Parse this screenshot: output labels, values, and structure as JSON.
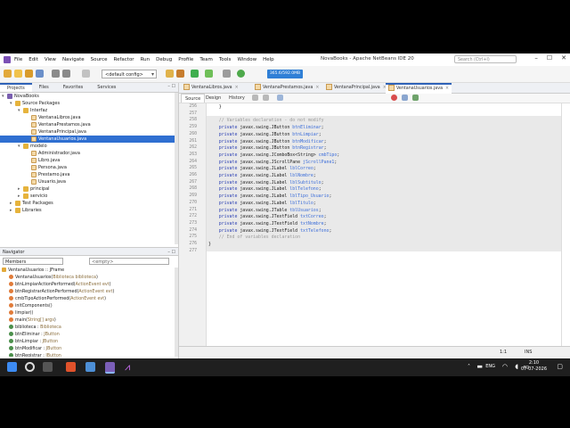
{
  "window": {
    "title": "NovaBooks - Apache NetBeans IDE 20",
    "search_placeholder": "Search (Ctrl+I)",
    "menu": [
      "File",
      "Edit",
      "View",
      "Navigate",
      "Source",
      "Refactor",
      "Run",
      "Debug",
      "Profile",
      "Team",
      "Tools",
      "Window",
      "Help"
    ],
    "controls": [
      "–",
      "☐",
      "✕"
    ]
  },
  "toolbar": {
    "config": "<default config>",
    "memory": "365.6/592.0MB"
  },
  "projects_panel": {
    "tabs": [
      "Projects",
      "Files",
      "Favorites",
      "Services"
    ],
    "active_tab": "Projects",
    "tree": [
      {
        "label": "NovaBooks",
        "level": 0,
        "icon": "project-icon",
        "arrow": "▾"
      },
      {
        "label": "Source Packages",
        "level": 1,
        "icon": "package-folder-icon",
        "arrow": "▾"
      },
      {
        "label": "Interfaz",
        "level": 2,
        "icon": "package-icon",
        "arrow": "▾"
      },
      {
        "label": "VentanaLibros.java",
        "level": 3,
        "icon": "java-file-icon",
        "arrow": ""
      },
      {
        "label": "VentanaPrestamos.java",
        "level": 3,
        "icon": "java-file-icon",
        "arrow": ""
      },
      {
        "label": "VentanaPrincipal.java",
        "level": 3,
        "icon": "java-file-icon",
        "arrow": ""
      },
      {
        "label": "VentanaUsuarios.java",
        "level": 3,
        "icon": "java-file-icon",
        "arrow": "",
        "selected": true
      },
      {
        "label": "modelo",
        "level": 2,
        "icon": "package-icon",
        "arrow": "▾"
      },
      {
        "label": "Administrador.java",
        "level": 3,
        "icon": "java-file-icon",
        "arrow": ""
      },
      {
        "label": "Libro.java",
        "level": 3,
        "icon": "java-file-icon",
        "arrow": ""
      },
      {
        "label": "Persona.java",
        "level": 3,
        "icon": "java-file-icon",
        "arrow": ""
      },
      {
        "label": "Prestamo.java",
        "level": 3,
        "icon": "java-file-icon",
        "arrow": ""
      },
      {
        "label": "Usuario.java",
        "level": 3,
        "icon": "java-file-icon",
        "arrow": ""
      },
      {
        "label": "principal",
        "level": 2,
        "icon": "package-icon",
        "arrow": "▸"
      },
      {
        "label": "servicio",
        "level": 2,
        "icon": "package-icon",
        "arrow": "▸"
      },
      {
        "label": "Test Packages",
        "level": 1,
        "icon": "package-folder-icon",
        "arrow": "▸"
      },
      {
        "label": "Libraries",
        "level": 1,
        "icon": "library-icon",
        "arrow": "▸"
      }
    ]
  },
  "navigator": {
    "title": "Navigator",
    "members_label": "Members",
    "filter_label": "<empty>",
    "root": "VentanaUsuarios :: JFrame",
    "items": [
      {
        "name": "VentanaUsuarios(",
        "type": "Biblioteca biblioteca",
        "tail": ")"
      },
      {
        "name": "btnLimpiarActionPerformed(",
        "type": "ActionEvent evt",
        "tail": ")"
      },
      {
        "name": "btnRegistrarActionPerformed(",
        "type": "ActionEvent evt",
        "tail": ")"
      },
      {
        "name": "cmbTipoActionPerformed(",
        "type": "ActionEvent evt",
        "tail": ")"
      },
      {
        "name": "initComponents()",
        "type": "",
        "tail": ""
      },
      {
        "name": "limpiar()",
        "type": "",
        "tail": ""
      },
      {
        "name": "main(",
        "type": "String[] args",
        "tail": ")"
      },
      {
        "name": "biblioteca : ",
        "type": "Biblioteca",
        "tail": ""
      },
      {
        "name": "btnEliminar : ",
        "type": "JButton",
        "tail": ""
      },
      {
        "name": "btnLimpiar : ",
        "type": "JButton",
        "tail": ""
      },
      {
        "name": "btnModificar : ",
        "type": "JButton",
        "tail": ""
      },
      {
        "name": "btnRegistrar : ",
        "type": "JButton",
        "tail": ""
      }
    ]
  },
  "editor": {
    "tabs": [
      "VentanaLibros.java",
      "VentanaPrestamos.java",
      "VentanaPrincipal.java",
      "VentanaUsuarios.java"
    ],
    "active_tab": "VentanaUsuarios.java",
    "views": [
      "Source",
      "Design",
      "History"
    ],
    "active_view": "Source",
    "lines": [
      {
        "n": "256",
        "code": "    }"
      },
      {
        "n": "257",
        "code": ""
      },
      {
        "n": "258",
        "code": "    // Variables declaration - do not modify"
      },
      {
        "n": "259",
        "code": "    private javax.swing.JButton btnEliminar;"
      },
      {
        "n": "260",
        "code": "    private javax.swing.JButton btnLimpiar;"
      },
      {
        "n": "261",
        "code": "    private javax.swing.JButton btnModificar;"
      },
      {
        "n": "262",
        "code": "    private javax.swing.JButton btnRegistrar;"
      },
      {
        "n": "263",
        "code": "    private javax.swing.JComboBox<String> cmbTipo;"
      },
      {
        "n": "264",
        "code": "    private javax.swing.JScrollPane jScrollPane1;"
      },
      {
        "n": "265",
        "code": "    private javax.swing.JLabel lblCorreo;"
      },
      {
        "n": "266",
        "code": "    private javax.swing.JLabel lblNombre;"
      },
      {
        "n": "267",
        "code": "    private javax.swing.JLabel lblSubtitulo;"
      },
      {
        "n": "268",
        "code": "    private javax.swing.JLabel lblTelefono;"
      },
      {
        "n": "269",
        "code": "    private javax.swing.JLabel lblTipo_Usuario;"
      },
      {
        "n": "270",
        "code": "    private javax.swing.JLabel lblTitulo;"
      },
      {
        "n": "271",
        "code": "    private javax.swing.JTable tblUsuarios;"
      },
      {
        "n": "272",
        "code": "    private javax.swing.JTextField txtCorreo;"
      },
      {
        "n": "273",
        "code": "    private javax.swing.JTextField txtNombre;"
      },
      {
        "n": "274",
        "code": "    private javax.swing.JTextField txtTelefono;"
      },
      {
        "n": "275",
        "code": "    // End of variables declaration"
      },
      {
        "n": "276",
        "code": "}"
      },
      {
        "n": "277",
        "code": ""
      }
    ]
  },
  "status": {
    "caret": "1:1",
    "mode": "INS"
  },
  "taskbar": {
    "time": "2:10",
    "date": "07-07-2026",
    "lang": "ENG"
  },
  "colors": {
    "selection": "#2f6fd1",
    "keyword": "#2a3fb3",
    "identifier": "#3b6dd9",
    "comment": "#9a9a9a",
    "accent": "#2f63b8"
  }
}
